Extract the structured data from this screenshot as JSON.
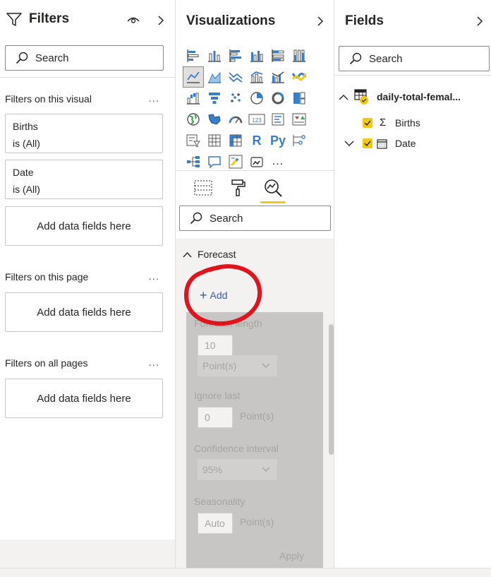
{
  "filters": {
    "title": "Filters",
    "search_placeholder": "Search",
    "sections": [
      {
        "title": "Filters on this visual",
        "more": "..."
      },
      {
        "title": "Filters on this page",
        "more": "..."
      },
      {
        "title": "Filters on all pages",
        "more": "..."
      }
    ],
    "cards": [
      {
        "field": "Births",
        "condition": "is (All)"
      },
      {
        "field": "Date",
        "condition": "is (All)"
      }
    ],
    "add_data_fields": "Add data fields here"
  },
  "visualizations": {
    "title": "Visualizations",
    "more_icon": "...",
    "r_label": "R",
    "py_label": "Py",
    "kpi_label": "123",
    "search_placeholder": "Search",
    "forecast": {
      "header": "Forecast",
      "add_label": "Add",
      "forecast_length_label": "Forecast length",
      "forecast_length_value": "10",
      "forecast_unit": "Point(s)",
      "ignore_last_label": "Ignore last",
      "ignore_last_value": "0",
      "ignore_last_unit": "Point(s)",
      "confidence_label": "Confidence interval",
      "confidence_value": "95%",
      "seasonality_label": "Seasonality",
      "seasonality_value": "Auto",
      "seasonality_unit": "Point(s)",
      "apply_label": "Apply"
    }
  },
  "fields": {
    "title": "Fields",
    "search_placeholder": "Search",
    "table_name": "daily-total-femal...",
    "items": [
      {
        "name": "Births",
        "type": "sigma",
        "checked": true
      },
      {
        "name": "Date",
        "type": "calendar",
        "checked": true
      }
    ]
  },
  "colors": {
    "accent_yellow": "#f2c811",
    "annotation_red": "#e0141c",
    "link_blue": "#3a5a9e",
    "icon_blue": "#3c7ec6"
  }
}
